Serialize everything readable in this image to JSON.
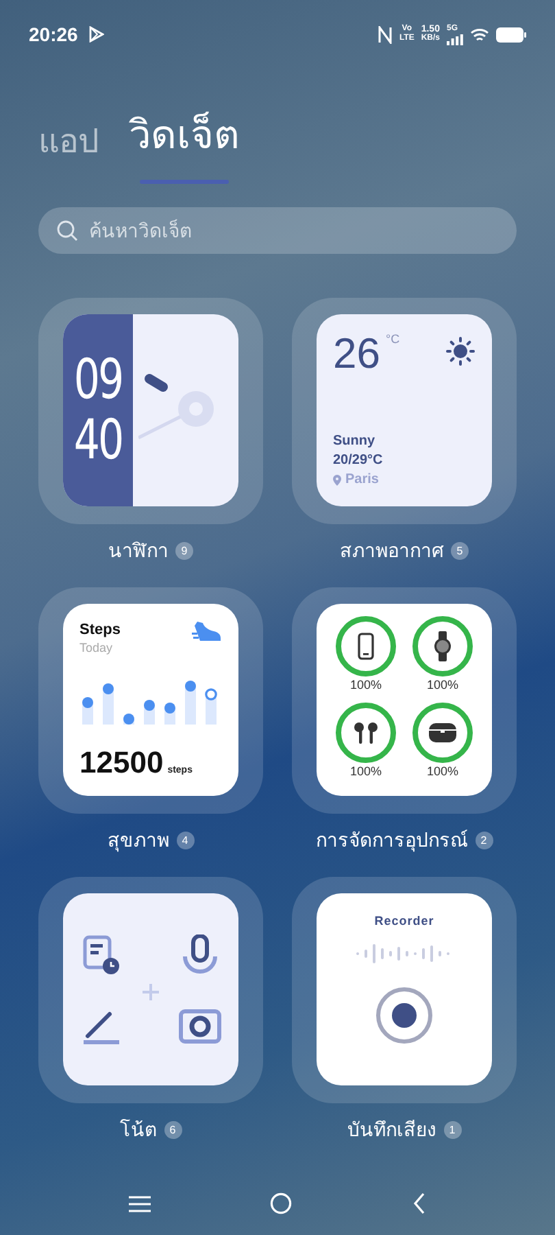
{
  "status_bar": {
    "time": "20:26",
    "volte": [
      "Vo",
      "LTE"
    ],
    "speed": [
      "1.50",
      "KB/s"
    ],
    "network": "5G"
  },
  "tabs": [
    {
      "label": "แอป",
      "selected": false
    },
    {
      "label": "วิดเจ็ต",
      "selected": true
    }
  ],
  "search": {
    "placeholder": "ค้นหาวิดเจ็ต"
  },
  "widgets": [
    {
      "kind": "clock",
      "label": "นาฬิกา",
      "count": "9",
      "hours": "09",
      "minutes": "40"
    },
    {
      "kind": "weather",
      "label": "สภาพอากาศ",
      "count": "5",
      "temperature": "26",
      "unit": "°C",
      "condition": "Sunny",
      "range": "20/29°C",
      "city": "Paris"
    },
    {
      "kind": "steps",
      "label": "สุขภาพ",
      "count": "4",
      "title": "Steps",
      "subtitle": "Today",
      "value": "12500",
      "unit": "steps"
    },
    {
      "kind": "devices",
      "label": "การจัดการอุปกรณ์",
      "count": "2",
      "devices": [
        {
          "kind": "phone",
          "reading": "100%"
        },
        {
          "kind": "watch",
          "reading": "100%"
        },
        {
          "kind": "earbuds",
          "reading": "100%"
        },
        {
          "kind": "case",
          "reading": "100%"
        }
      ]
    },
    {
      "kind": "notes",
      "label": "โน้ต",
      "count": "6"
    },
    {
      "kind": "recorder",
      "label": "บันทึกเสียง",
      "count": "1",
      "title": "Recorder"
    }
  ]
}
